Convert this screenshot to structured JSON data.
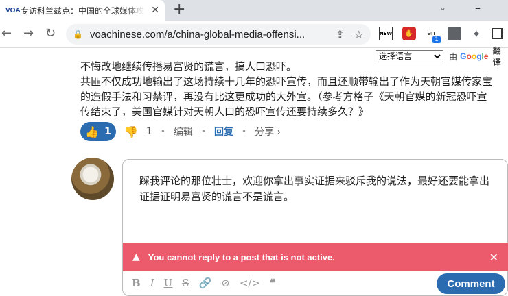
{
  "browser": {
    "tab_favicon": "VOA",
    "tab_title": "专访科兰兹克：中国的全球媒体攻势",
    "tab_close": "✕",
    "new_tab": "+",
    "url": "voachinese.com/a/china-global-media-offensi...",
    "extension_en_badge": "1"
  },
  "translate": {
    "select_label": "选择语言",
    "by": "由",
    "google": [
      "G",
      "o",
      "o",
      "g",
      "l",
      "e"
    ],
    "action": "翻译"
  },
  "comment": {
    "lines": [
      "不悔改地继续传播易富贤的谎言，搞人口恐吓。",
      "共匪不仅成功地输出了这场持续十几年的恐吓宣传，而且还顺带输出了作为天朝官媒传家宝",
      "的造假手法和习禁评，再没有比这更成功的大外宣。（参考方格子《天朝官媒的新冠恐吓宣",
      "传结束了，美国官媒针对天朝人口的恐吓宣传还要持续多久？》"
    ],
    "likes": "1",
    "dislikes": "1",
    "edit_label": "编辑",
    "reply_label": "回复",
    "share_label": "分享 ›"
  },
  "reply_box": {
    "text": "踩我评论的那位壮士，欢迎你拿出事实证据来驳斥我的说法，最好还要能拿出证据证明易富贤的谎言不是谎言。",
    "error_message": "You cannot reply to a post that is not active.",
    "submit_label": "Comment"
  },
  "colors": {
    "accent": "#2b6cb0",
    "error": "#ec5b6b"
  }
}
